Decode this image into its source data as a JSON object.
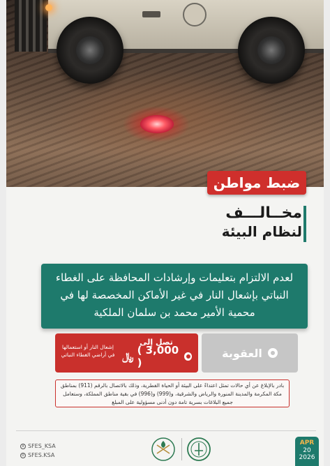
{
  "header": {
    "tag": "ضبط مواطن",
    "title_line1": "مخــالـــف",
    "title_line2": "لنظام البيئة"
  },
  "statement": {
    "text": "لعدم الالتزام بتعليمات وإرشادات المحافظة على الغطاء النباتي بإشعال النار في غير الأماكن المخصصة لها في محمية الأمير محمد بن سلمان الملكية"
  },
  "penalty": {
    "label": "العقوبة",
    "up_to": "تصل إلى",
    "amount": "( 3,000 )",
    "currency": "﷼",
    "caption": "إشعال النار أو استعمالها في أراضي الغطاء النباتي"
  },
  "notice": {
    "text": "بادر بالإبلاغ عن أي حالات تمثل اعتداءً على البيئة أو الحياة الفطرية، وذلك بالاتصال بالرقم (911) بمناطق مكة المكرمة والمدينة المنورة والرياض والشرقية، و(999) و(996) في بقية مناطق المملكة، وستعامل جميع البلاغات بسرية تامة دون أدنى مسؤولية على المبلغ"
  },
  "footer": {
    "handles": [
      "SFES_KSA",
      "SFES.KSA"
    ],
    "date": {
      "month": "APR",
      "day": "20",
      "year": "2026"
    }
  },
  "colors": {
    "accent_red": "#c9302c",
    "accent_teal": "#1e7a6c",
    "penalty_gray": "#c6c6c6"
  }
}
